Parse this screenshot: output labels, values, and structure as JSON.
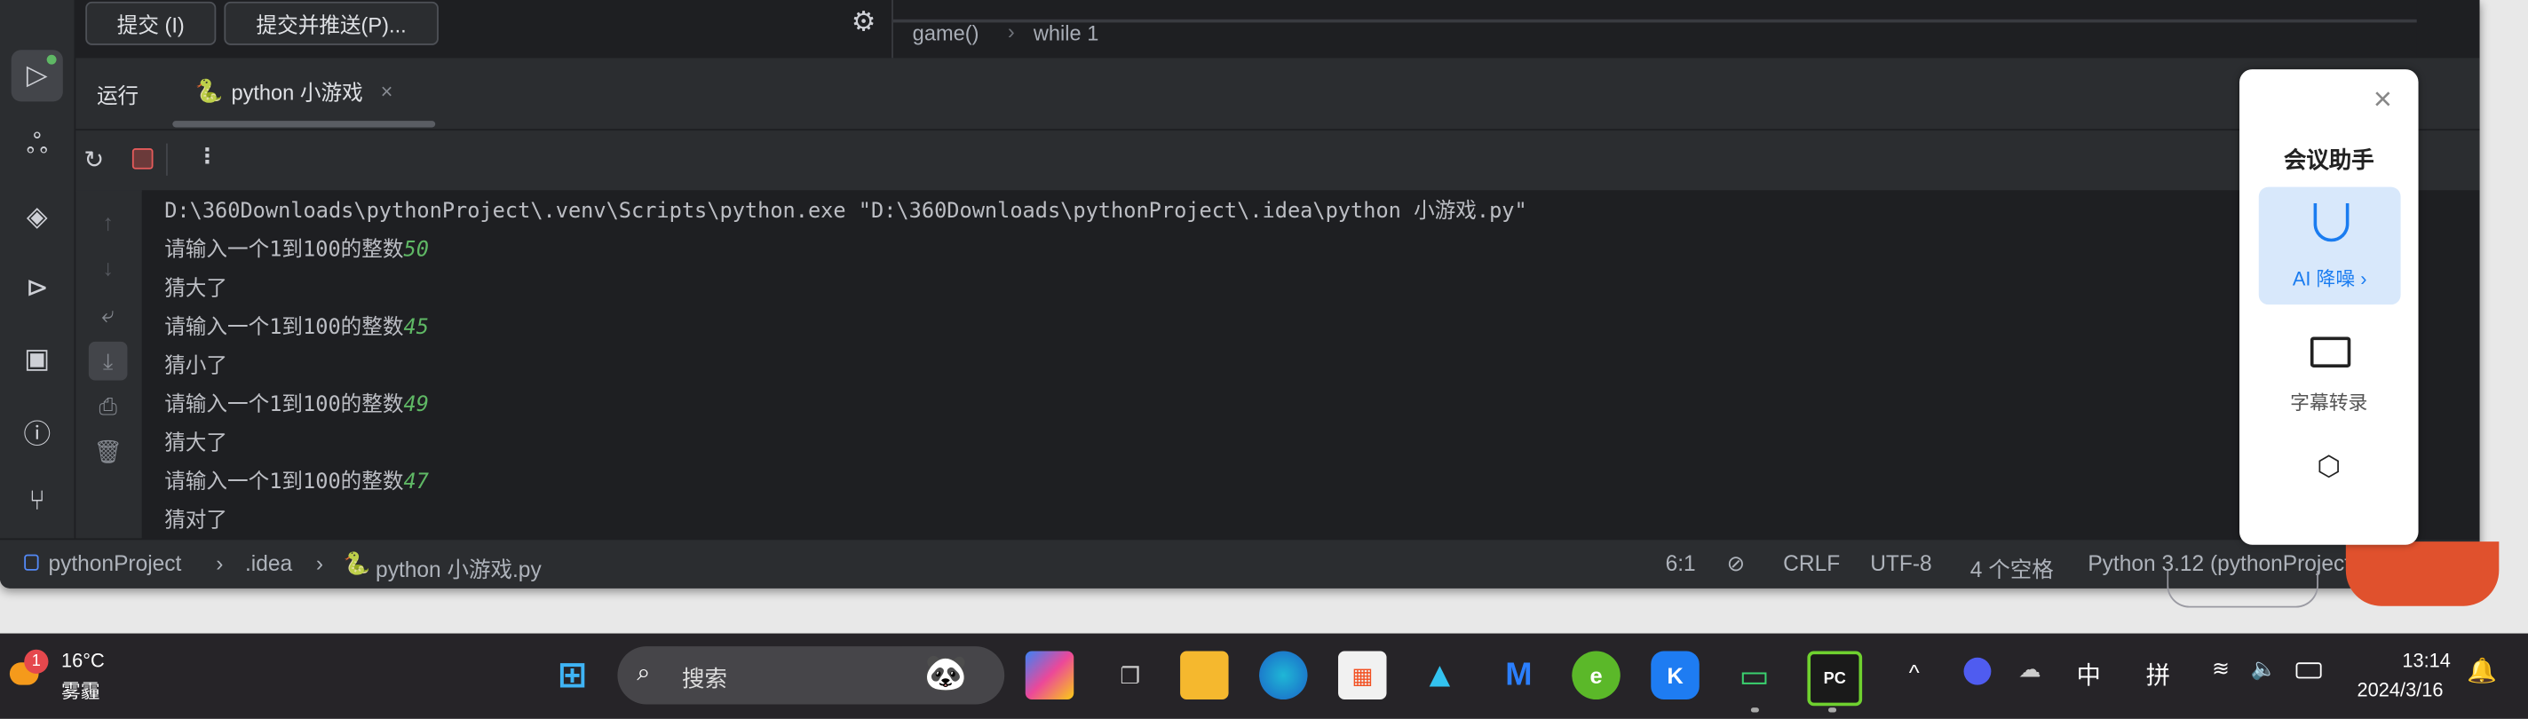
{
  "vcs": {
    "commit_label": "提交 (I)",
    "commit_push_label": "提交并推送(P)..."
  },
  "editor": {
    "breadcrumb": [
      "game()",
      "while 1"
    ]
  },
  "run": {
    "title": "运行",
    "tab_label": "python 小游戏"
  },
  "console": {
    "command": "D:\\360Downloads\\pythonProject\\.venv\\Scripts\\python.exe \"D:\\360Downloads\\pythonProject\\.idea\\python 小游戏.py\"",
    "lines": [
      {
        "text": "请输入一个1到100的整数",
        "input": "50"
      },
      {
        "text": "猜大了"
      },
      {
        "text": "请输入一个1到100的整数",
        "input": "45"
      },
      {
        "text": "猜小了"
      },
      {
        "text": "请输入一个1到100的整数",
        "input": "49"
      },
      {
        "text": "猜大了"
      },
      {
        "text": "请输入一个1到100的整数",
        "input": "47"
      },
      {
        "text": "猜对了"
      }
    ]
  },
  "statusbar": {
    "path": [
      "pythonProject",
      ".idea",
      "python 小游戏.py"
    ],
    "position": "6:1",
    "line_ending": "CRLF",
    "encoding": "UTF-8",
    "indent": "4 个空格",
    "interpreter": "Python 3.12 (pythonProject)"
  },
  "meeting_assistant": {
    "title": "会议助手",
    "noise_label": "AI 降噪",
    "caption_label": "字幕转录",
    "accent": "#1a7cf0"
  },
  "taskbar": {
    "weather_temp": "16°C",
    "weather_desc": "雾霾",
    "weather_badge": "1",
    "search_placeholder": "搜索",
    "ime_lang": "中",
    "ime_mode": "拼",
    "time": "13:14",
    "date": "2024/3/16"
  },
  "colors": {
    "input_number": "#5fb865",
    "ide_bg": "#1e1f22",
    "panel_bg": "#2b2d30"
  }
}
